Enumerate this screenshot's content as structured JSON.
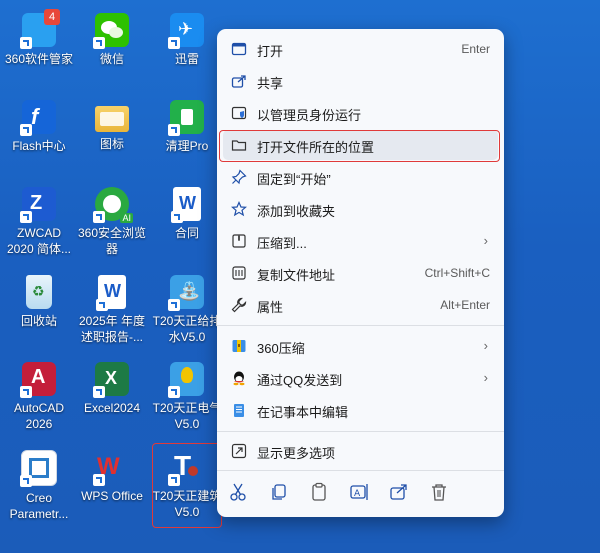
{
  "desktop_icons": [
    {
      "id": "360guanjia",
      "label": "360软件管家",
      "icon": "360-software-manager-icon",
      "color": "#2aa0f0",
      "badge": "4"
    },
    {
      "id": "wechat",
      "label": "微信",
      "icon": "wechat-icon",
      "color": "#2dc100"
    },
    {
      "id": "xunlei",
      "label": "迅雷",
      "icon": "xunlei-icon",
      "color": "#1a8cf0"
    },
    {
      "id": "flash",
      "label": "Flash中心",
      "icon": "flash-icon",
      "color": "#1565d8"
    },
    {
      "id": "tubiao",
      "label": "图标",
      "icon": "folder-icon",
      "color": "#f2c24a"
    },
    {
      "id": "qingli",
      "label": "清理Pro",
      "icon": "cleaner-icon",
      "color": "#22b04a"
    },
    {
      "id": "zwcad",
      "label": "ZWCAD\n2020 简体...",
      "icon": "zwcad-icon",
      "color": "#1d5bd1"
    },
    {
      "id": "360browser",
      "label": "360安全浏览\n器",
      "icon": "360-browser-icon",
      "color": "#2aa940"
    },
    {
      "id": "hetong",
      "label": "合同",
      "icon": "word-doc-icon",
      "color": "#ffffff"
    },
    {
      "id": "recycle",
      "label": "回收站",
      "icon": "recycle-bin-icon",
      "color": "#d9edf9"
    },
    {
      "id": "report",
      "label": "2025年 年度\n述职报告-...",
      "icon": "word-doc-icon",
      "color": "#ffffff"
    },
    {
      "id": "t20water",
      "label": "T20天正给排\n水V5.0",
      "icon": "t20-water-icon",
      "color": "#3ba0e6"
    },
    {
      "id": "autocad",
      "label": "AutoCAD\n2026",
      "icon": "autocad-icon",
      "color": "#c41e3a"
    },
    {
      "id": "excel",
      "label": "Excel2024",
      "icon": "excel-icon",
      "color": "#1d7a45"
    },
    {
      "id": "t20elec",
      "label": "T20天正电气\nV5.0",
      "icon": "t20-electric-icon",
      "color": "#f2c400"
    },
    {
      "id": "creo",
      "label": "Creo\nParametr...",
      "icon": "creo-icon",
      "color": "#ffffff"
    },
    {
      "id": "wps",
      "label": "WPS Office",
      "icon": "wps-icon",
      "color": "#e03030"
    },
    {
      "id": "t20arch",
      "label": "T20天正建筑\nV5.0",
      "icon": "t20-architecture-icon",
      "color": "#ffffff"
    }
  ],
  "context_menu": {
    "items": [
      {
        "label": "打开",
        "shortcut": "Enter",
        "icon": "open-window-icon"
      },
      {
        "label": "共享",
        "shortcut": "",
        "icon": "share-icon"
      },
      {
        "label": "以管理员身份运行",
        "shortcut": "",
        "icon": "shield-icon"
      },
      {
        "label": "打开文件所在的位置",
        "shortcut": "",
        "icon": "folder-open-icon"
      },
      {
        "label": "固定到“开始”",
        "shortcut": "",
        "icon": "pin-icon"
      },
      {
        "label": "添加到收藏夹",
        "shortcut": "",
        "icon": "star-icon"
      },
      {
        "label": "压缩到...",
        "shortcut": "",
        "icon": "archive-icon"
      },
      {
        "label": "复制文件地址",
        "shortcut": "Ctrl+Shift+C",
        "icon": "copy-path-icon"
      },
      {
        "label": "属性",
        "shortcut": "Alt+Enter",
        "icon": "wrench-icon"
      },
      {
        "label": "360压缩",
        "shortcut": "",
        "icon": "360-zip-icon"
      },
      {
        "label": "通过QQ发送到",
        "shortcut": "",
        "icon": "qq-icon"
      },
      {
        "label": "在记事本中编辑",
        "shortcut": "",
        "icon": "notepad-icon"
      },
      {
        "label": "显示更多选项",
        "shortcut": "",
        "icon": "more-options-icon"
      }
    ],
    "toolbar": [
      "cut-icon",
      "copy-icon",
      "paste-icon",
      "rename-icon",
      "share-icon",
      "delete-icon"
    ],
    "highlighted_item": "打开文件所在的位置"
  },
  "accent_color": "#e03a3a"
}
